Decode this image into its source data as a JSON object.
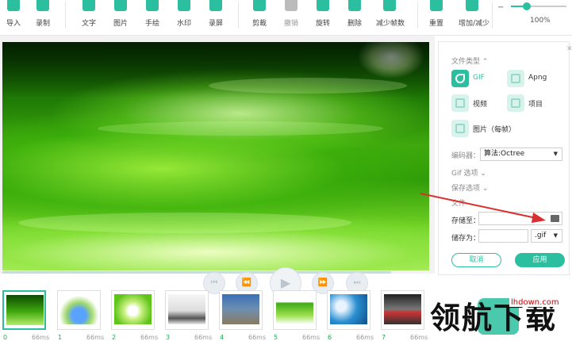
{
  "toolbar": {
    "items": [
      {
        "label": "导入",
        "icon": "import-icon"
      },
      {
        "label": "录制",
        "icon": "record-icon"
      },
      {
        "label": "文字",
        "icon": "text-icon"
      },
      {
        "label": "图片",
        "icon": "image-icon"
      },
      {
        "label": "手绘",
        "icon": "draw-icon"
      },
      {
        "label": "水印",
        "icon": "watermark-icon"
      },
      {
        "label": "录屏",
        "icon": "screen-record-icon"
      },
      {
        "label": "剪裁",
        "icon": "crop-icon"
      },
      {
        "label": "撤销",
        "icon": "undo-icon"
      },
      {
        "label": "旋转",
        "icon": "rotate-icon"
      },
      {
        "label": "删除",
        "icon": "delete-icon"
      },
      {
        "label": "减少帧数",
        "icon": "reduce-frames-icon"
      },
      {
        "label": "重置",
        "icon": "reset-icon"
      },
      {
        "label": "增加/减少",
        "icon": "delay-icon"
      }
    ],
    "zoom": {
      "value": "100%",
      "level": 0.28
    }
  },
  "player": {
    "controls": [
      "first-frame-icon",
      "prev-frame-icon",
      "play-icon",
      "next-frame-icon",
      "last-frame-icon"
    ]
  },
  "panel": {
    "file_type_label": "文件类型",
    "file_types": [
      {
        "label": "GIF",
        "selected": true
      },
      {
        "label": "Apng",
        "selected": false
      },
      {
        "label": "视频",
        "selected": false
      },
      {
        "label": "项目",
        "selected": false
      },
      {
        "label": "图片（每帧）",
        "selected": false
      }
    ],
    "encoder_label": "编码器：",
    "encoder_value": "算法:Octree",
    "gif_options": "Gif 选项",
    "save_options": "保存选项",
    "file_section": "文件",
    "save_to_label": "存储至：",
    "save_to_value": "",
    "save_as_label": "储存为：",
    "save_as_value": "",
    "extension": ".gif",
    "cancel": "取消",
    "apply": "应用"
  },
  "frames": [
    {
      "num": "0",
      "ms": "66ms"
    },
    {
      "num": "1",
      "ms": "66ms"
    },
    {
      "num": "2",
      "ms": "66ms"
    },
    {
      "num": "3",
      "ms": "66ms"
    },
    {
      "num": "4",
      "ms": "66ms"
    },
    {
      "num": "5",
      "ms": "66ms"
    },
    {
      "num": "6",
      "ms": "66ms"
    },
    {
      "num": "7",
      "ms": "66ms"
    }
  ],
  "watermark": {
    "text": "领航下载",
    "url": "lhdown.com"
  },
  "colors": {
    "accent": "#2bbf9f",
    "arrow": "#d9302f"
  }
}
